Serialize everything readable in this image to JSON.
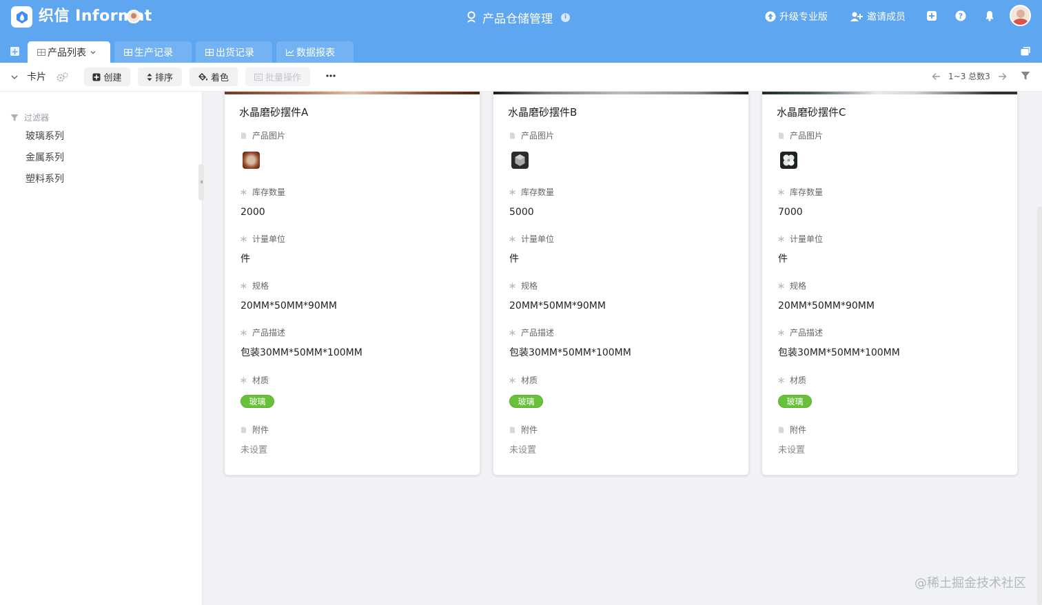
{
  "header": {
    "brand": "织信 Informat",
    "app_title": "产品仓储管理",
    "upgrade_label": "升级专业版",
    "invite_label": "邀请成员",
    "accent_color": "#5fa6f0"
  },
  "tabs": [
    {
      "label": "产品列表",
      "active": true
    },
    {
      "label": "生产记录",
      "active": false
    },
    {
      "label": "出货记录",
      "active": false
    },
    {
      "label": "数据报表",
      "active": false
    }
  ],
  "toolbar": {
    "view_label": "卡片",
    "create_label": "创建",
    "sort_label": "排序",
    "color_label": "着色",
    "batch_label": "批量操作",
    "pager_text": "1~3 总数3"
  },
  "sidebar": {
    "filter_label": "过滤器",
    "items": [
      "玻璃系列",
      "金属系列",
      "塑料系列"
    ]
  },
  "field_labels": {
    "image": "产品图片",
    "stock": "库存数量",
    "unit": "计量单位",
    "spec": "规格",
    "desc": "产品描述",
    "material": "材质",
    "attachment": "附件"
  },
  "cards": [
    {
      "title": "水晶磨砂摆件A",
      "stock": "2000",
      "unit": "件",
      "spec": "20MM*50MM*90MM",
      "desc": "包装30MM*50MM*100MM",
      "material": "玻璃",
      "attachment": "未设置",
      "thumb": "brown-round"
    },
    {
      "title": "水晶磨砂摆件B",
      "stock": "5000",
      "unit": "件",
      "spec": "20MM*50MM*90MM",
      "desc": "包装30MM*50MM*100MM",
      "material": "玻璃",
      "attachment": "未设置",
      "thumb": "gray-hexagon"
    },
    {
      "title": "水晶磨砂摆件C",
      "stock": "7000",
      "unit": "件",
      "spec": "20MM*50MM*90MM",
      "desc": "包装30MM*50MM*100MM",
      "material": "玻璃",
      "attachment": "未设置",
      "thumb": "white-clover"
    }
  ],
  "watermark": "@稀土掘金技术社区"
}
